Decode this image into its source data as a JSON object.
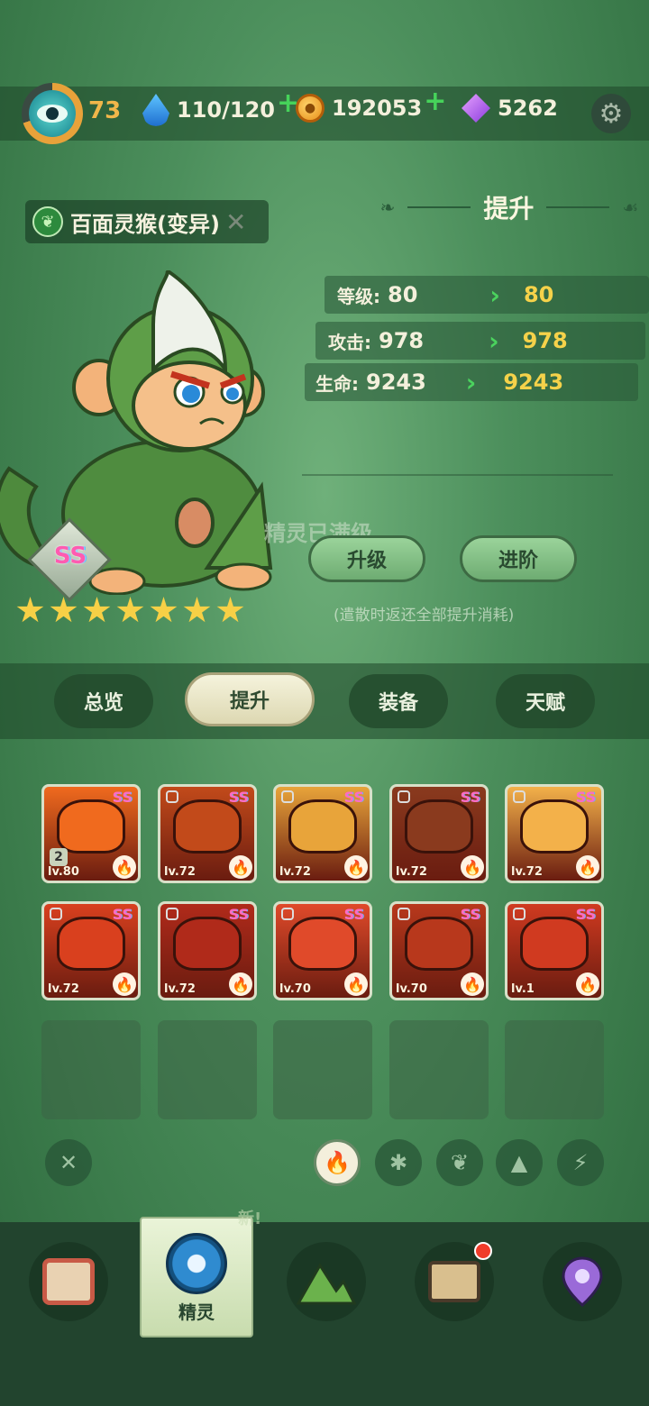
{
  "header": {
    "player_level": "73",
    "stamina": "110/120",
    "coins": "192053",
    "gems": "5262",
    "icons": [
      "eye-avatar-icon",
      "water-drop-icon",
      "paw-coin-icon",
      "purple-gem-icon",
      "gear-icon"
    ]
  },
  "pet": {
    "name": "百面灵猴(变异)",
    "grade": "SS",
    "stars": 7
  },
  "upgrade_panel": {
    "title": "提升",
    "stats": [
      {
        "label": "等级:",
        "current": "80",
        "next": "80"
      },
      {
        "label": "攻击:",
        "current": "978",
        "next": "978"
      },
      {
        "label": "生命:",
        "current": "9243",
        "next": "9243"
      }
    ],
    "max_level_text": "精灵已满级",
    "upgrade_button": "升级",
    "advance_button": "进阶",
    "note": "(遣散时返还全部提升消耗)"
  },
  "tabs": [
    {
      "label": "总览"
    },
    {
      "label": "提升"
    },
    {
      "label": "装备"
    },
    {
      "label": "天赋"
    }
  ],
  "pets_grid": [
    {
      "level": "lv.80",
      "grade": "SS",
      "badge": "2",
      "locked": false,
      "color": "#f06a1e"
    },
    {
      "level": "lv.72",
      "grade": "SS",
      "locked": true,
      "color": "#c24a1a"
    },
    {
      "level": "lv.72",
      "grade": "SS",
      "locked": true,
      "color": "#e8a43a"
    },
    {
      "level": "lv.72",
      "grade": "SS",
      "locked": true,
      "color": "#8a3a1e"
    },
    {
      "level": "lv.72",
      "grade": "SS",
      "locked": true,
      "color": "#f3b14a"
    },
    {
      "level": "lv.72",
      "grade": "SS",
      "locked": true,
      "color": "#d9401e"
    },
    {
      "level": "lv.72",
      "grade": "SS",
      "locked": true,
      "color": "#b02a1a"
    },
    {
      "level": "lv.70",
      "grade": "SS",
      "locked": true,
      "color": "#e04a2a"
    },
    {
      "level": "lv.70",
      "grade": "SS",
      "locked": true,
      "color": "#b8381c"
    },
    {
      "level": "lv.1",
      "grade": "SS",
      "locked": true,
      "color": "#d03a20"
    }
  ],
  "filters": [
    "close-icon",
    "fire-icon",
    "wind-icon",
    "leaf-icon",
    "rock-icon",
    "lightning-icon"
  ],
  "bottom_nav": {
    "items": [
      "monitor-icon",
      "spirit-icon",
      "mountain-icon",
      "chest-icon",
      "map-pin-icon"
    ],
    "active_label": "精灵",
    "new_tag": "新!"
  }
}
